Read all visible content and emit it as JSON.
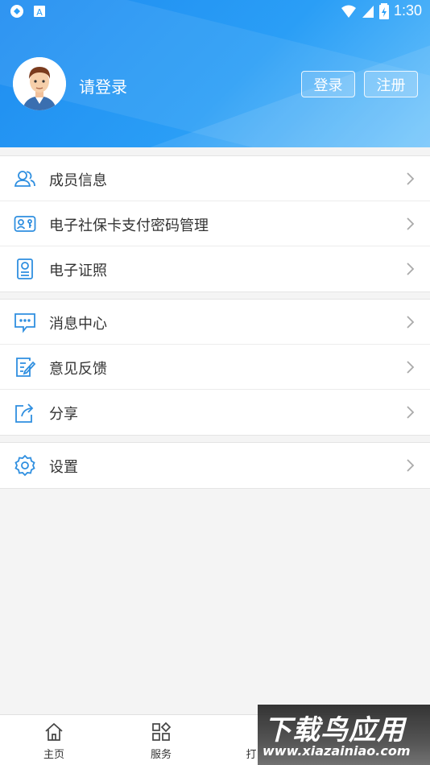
{
  "status_bar": {
    "time": "1:30"
  },
  "profile": {
    "prompt": "请登录",
    "login_label": "登录",
    "register_label": "注册"
  },
  "menu_groups": [
    {
      "items": [
        {
          "label": "成员信息",
          "icon": "members-icon"
        },
        {
          "label": "电子社保卡支付密码管理",
          "icon": "ss-card-password-icon"
        },
        {
          "label": "电子证照",
          "icon": "e-license-icon"
        }
      ]
    },
    {
      "items": [
        {
          "label": "消息中心",
          "icon": "message-icon"
        },
        {
          "label": "意见反馈",
          "icon": "feedback-icon"
        },
        {
          "label": "分享",
          "icon": "share-icon"
        }
      ]
    },
    {
      "items": [
        {
          "label": "设置",
          "icon": "settings-icon"
        }
      ]
    }
  ],
  "tabbar": {
    "tabs": [
      {
        "label": "主页",
        "icon": "home-icon"
      },
      {
        "label": "服务",
        "icon": "services-icon"
      },
      {
        "label": "打",
        "icon": ""
      }
    ]
  },
  "watermark": {
    "title": "下载鸟应用",
    "url": "www.xiazainiao.com"
  },
  "colors": {
    "header_blue": "#1e8cf0",
    "icon_blue": "#2f8fe0",
    "text": "#333333",
    "background": "#f4f4f4"
  }
}
